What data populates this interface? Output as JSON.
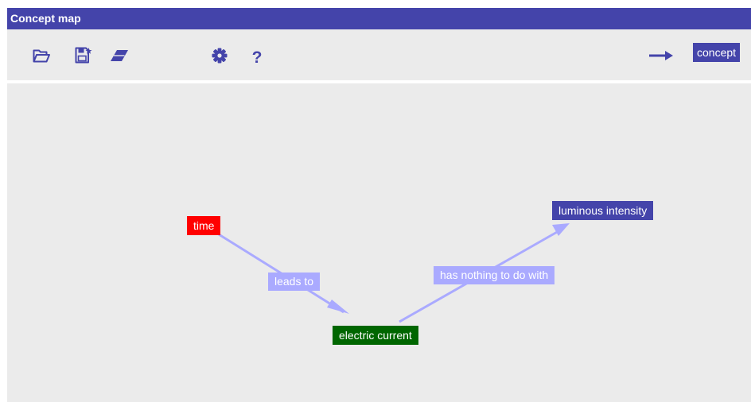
{
  "app": {
    "title": "Concept map"
  },
  "toolbar": {
    "open_icon": "folder-open-icon",
    "save_icon": "save-icon",
    "clear_icon": "eraser-icon",
    "settings_icon": "gear-icon",
    "help_icon": "question-mark-icon",
    "help_glyph": "?",
    "link_icon": "arrow-right-icon",
    "concept_button_label": "concept"
  },
  "colors": {
    "accent": "#4444aa",
    "background": "#ebebeb",
    "link": "#aaaaff",
    "time_node": "#ff0000",
    "electric_current_node": "#006600",
    "luminous_intensity_node": "#4444aa"
  },
  "map": {
    "concepts": [
      {
        "id": "time",
        "label": "time",
        "color": "#ff0000"
      },
      {
        "id": "electric-current",
        "label": "electric current",
        "color": "#006600"
      },
      {
        "id": "luminous-intensity",
        "label": "luminous intensity",
        "color": "#4444aa"
      }
    ],
    "links": [
      {
        "from": "time",
        "to": "electric-current",
        "label": "leads to"
      },
      {
        "from": "electric-current",
        "to": "luminous-intensity",
        "label": "has nothing to do with"
      }
    ]
  }
}
